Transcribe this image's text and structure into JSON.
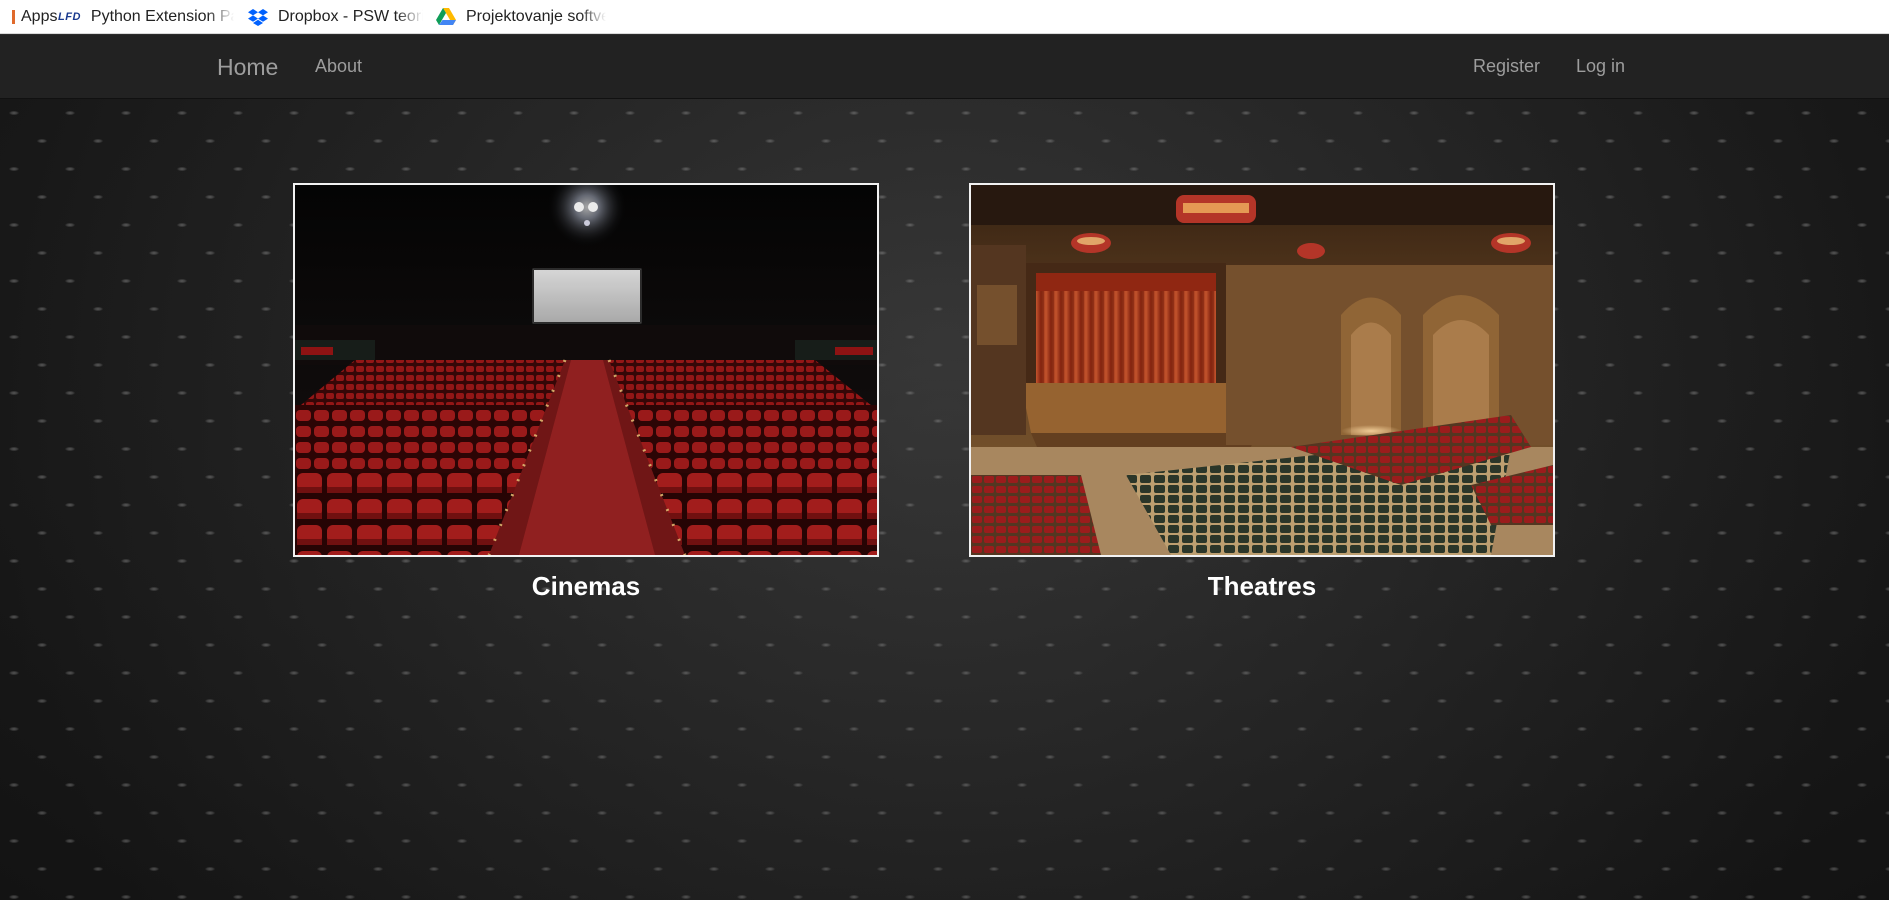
{
  "bookmarks": [
    {
      "label": "Apps",
      "icon": "apps-icon"
    },
    {
      "label": "Python Extension Pac",
      "icon": "lfd-icon",
      "icon_text": "LFD"
    },
    {
      "label": "Dropbox - PSW teorij",
      "icon": "dropbox-icon"
    },
    {
      "label": "Projektovanje softver",
      "icon": "google-drive-icon"
    }
  ],
  "nav": {
    "brand": "Home",
    "about": "About",
    "register": "Register",
    "login": "Log in"
  },
  "cards": [
    {
      "caption": "Cinemas",
      "image": "cinema auditorium with red seats and screen"
    },
    {
      "caption": "Theatres",
      "image": "theatre auditorium with red curtain stage and green seats"
    }
  ],
  "colors": {
    "navbar_bg": "#222222",
    "nav_link": "#9d9d9d",
    "caption": "#ffffff",
    "card_border": "#f2f2f2"
  }
}
